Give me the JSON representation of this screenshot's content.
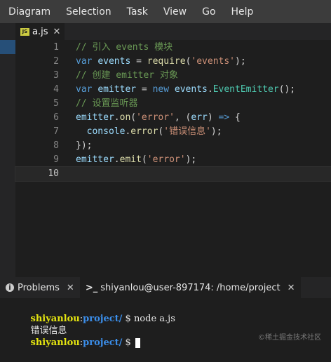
{
  "menu": [
    "Diagram",
    "Selection",
    "Task",
    "View",
    "Go",
    "Help"
  ],
  "tab": {
    "icon_text": "JS",
    "label": "a.js",
    "close": "✕"
  },
  "code_lines": [
    {
      "num": "1",
      "tokens": [
        {
          "c": "cm",
          "t": "// 引入 events 模块"
        }
      ]
    },
    {
      "num": "2",
      "tokens": [
        {
          "c": "kw",
          "t": "var"
        },
        {
          "c": "pn",
          "t": " "
        },
        {
          "c": "vr",
          "t": "events"
        },
        {
          "c": "pn",
          "t": " = "
        },
        {
          "c": "fn",
          "t": "require"
        },
        {
          "c": "pn",
          "t": "("
        },
        {
          "c": "st",
          "t": "'events'"
        },
        {
          "c": "pn",
          "t": ");"
        }
      ]
    },
    {
      "num": "3",
      "tokens": [
        {
          "c": "cm",
          "t": "// 创建 emitter 对象"
        }
      ]
    },
    {
      "num": "4",
      "tokens": [
        {
          "c": "kw",
          "t": "var"
        },
        {
          "c": "pn",
          "t": " "
        },
        {
          "c": "vr",
          "t": "emitter"
        },
        {
          "c": "pn",
          "t": " = "
        },
        {
          "c": "kw",
          "t": "new"
        },
        {
          "c": "pn",
          "t": " "
        },
        {
          "c": "vr",
          "t": "events"
        },
        {
          "c": "pn",
          "t": "."
        },
        {
          "c": "ty",
          "t": "EventEmitter"
        },
        {
          "c": "pn",
          "t": "();"
        }
      ]
    },
    {
      "num": "5",
      "tokens": [
        {
          "c": "cm",
          "t": "// 设置监听器"
        }
      ]
    },
    {
      "num": "6",
      "tokens": [
        {
          "c": "vr",
          "t": "emitter"
        },
        {
          "c": "pn",
          "t": "."
        },
        {
          "c": "fn",
          "t": "on"
        },
        {
          "c": "pn",
          "t": "("
        },
        {
          "c": "st",
          "t": "'error'"
        },
        {
          "c": "pn",
          "t": ", ("
        },
        {
          "c": "vr",
          "t": "err"
        },
        {
          "c": "pn",
          "t": ") "
        },
        {
          "c": "kw",
          "t": "=>"
        },
        {
          "c": "pn",
          "t": " {"
        }
      ]
    },
    {
      "num": "7",
      "tokens": [
        {
          "c": "pn",
          "t": "  "
        },
        {
          "c": "vr",
          "t": "console"
        },
        {
          "c": "pn",
          "t": "."
        },
        {
          "c": "fn",
          "t": "error"
        },
        {
          "c": "pn",
          "t": "("
        },
        {
          "c": "st",
          "t": "'错误信息'"
        },
        {
          "c": "pn",
          "t": ");"
        }
      ]
    },
    {
      "num": "8",
      "tokens": [
        {
          "c": "pn",
          "t": "});"
        }
      ]
    },
    {
      "num": "9",
      "tokens": [
        {
          "c": "vr",
          "t": "emitter"
        },
        {
          "c": "pn",
          "t": "."
        },
        {
          "c": "fn",
          "t": "emit"
        },
        {
          "c": "pn",
          "t": "("
        },
        {
          "c": "st",
          "t": "'error'"
        },
        {
          "c": "pn",
          "t": ");"
        }
      ]
    },
    {
      "num": "10",
      "tokens": [],
      "active": true
    }
  ],
  "panel": {
    "problems_icon": "i",
    "problems_label": "Problems",
    "problems_close": "✕",
    "terminal_icon": ">_",
    "terminal_label": "shiyanlou@user-897174: /home/project",
    "terminal_close": "✕"
  },
  "terminal": {
    "line1": {
      "user": "shiyanlou",
      "sep": ":",
      "path": "project/",
      "prompt": " $ ",
      "command": "node a.js"
    },
    "line2": "错误信息",
    "line3": {
      "user": "shiyanlou",
      "sep": ":",
      "path": "project/",
      "prompt": " $ "
    }
  },
  "watermark": "©稀土掘金技术社区"
}
